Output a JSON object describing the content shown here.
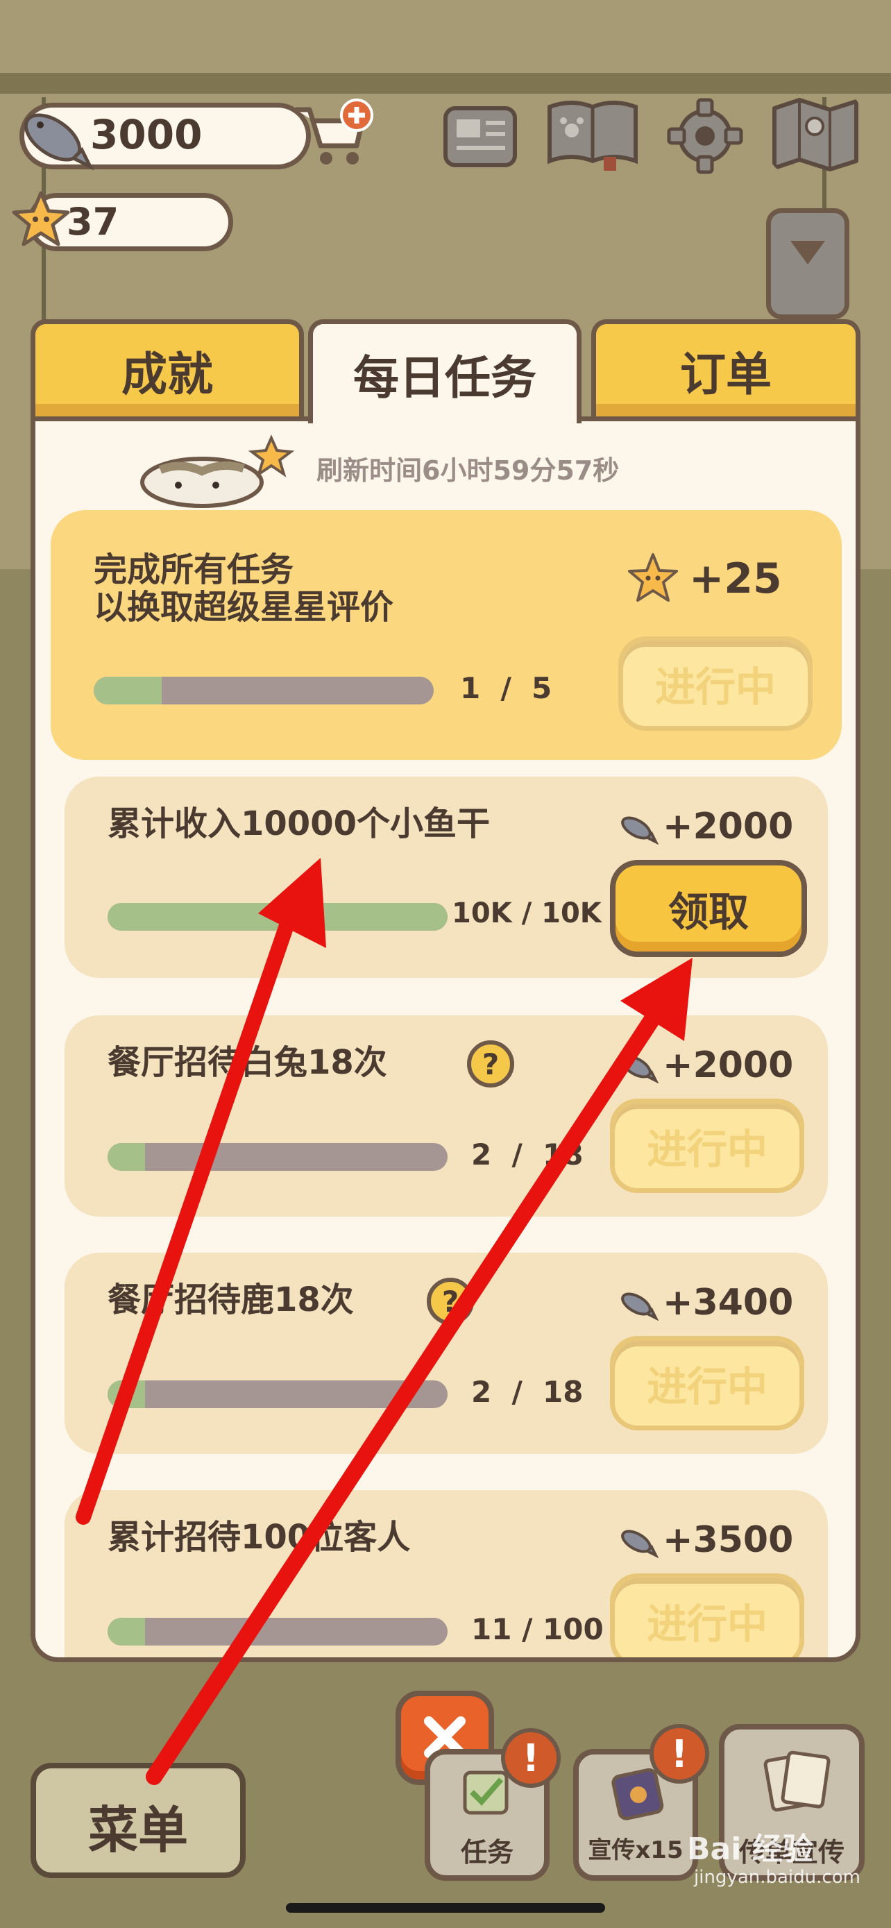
{
  "hud": {
    "fish_count": "3000",
    "star_count": "37"
  },
  "tabs": [
    {
      "label": "成就"
    },
    {
      "label": "每日任务"
    },
    {
      "label": "订单"
    }
  ],
  "refresh_text": "刷新时间6小时59分57秒",
  "tasks": [
    {
      "title_line1": "完成所有任务",
      "title_line2": "以换取超级星星评价",
      "reward": "+25",
      "reward_icon": "star-icon",
      "progress_text": "1  /  5",
      "progress": 0.2,
      "button": "进行中"
    },
    {
      "title": "累计收入10000个小鱼干",
      "reward": "+2000",
      "reward_icon": "fish-icon",
      "progress_text": "10K / 10K",
      "progress": 1.0,
      "button": "领取"
    },
    {
      "title": "餐厅招待白兔18次",
      "reward": "+2000",
      "reward_icon": "fish-icon",
      "progress_text": "2  /  18",
      "progress": 0.11,
      "button": "进行中"
    },
    {
      "title": "餐厅招待鹿18次",
      "reward": "+3400",
      "reward_icon": "fish-icon",
      "progress_text": "2  /  18",
      "progress": 0.11,
      "button": "进行中"
    },
    {
      "title": "累计招待100位客人",
      "reward": "+3500",
      "reward_icon": "fish-icon",
      "progress_text": "11 / 100",
      "progress": 0.11,
      "button": "进行中"
    }
  ],
  "bottom": {
    "menu_label": "菜单",
    "task_label": "任务",
    "promo_label": "宣传x15",
    "flyer_label": "传单宣传"
  },
  "watermark": {
    "line1": "Bai 经验",
    "line2": "jingyan.baidu.com"
  },
  "colors": {
    "accent": "#f8c541",
    "outline": "#6e5848",
    "panel": "#fdf6ea",
    "arrow": "#e8130f"
  }
}
